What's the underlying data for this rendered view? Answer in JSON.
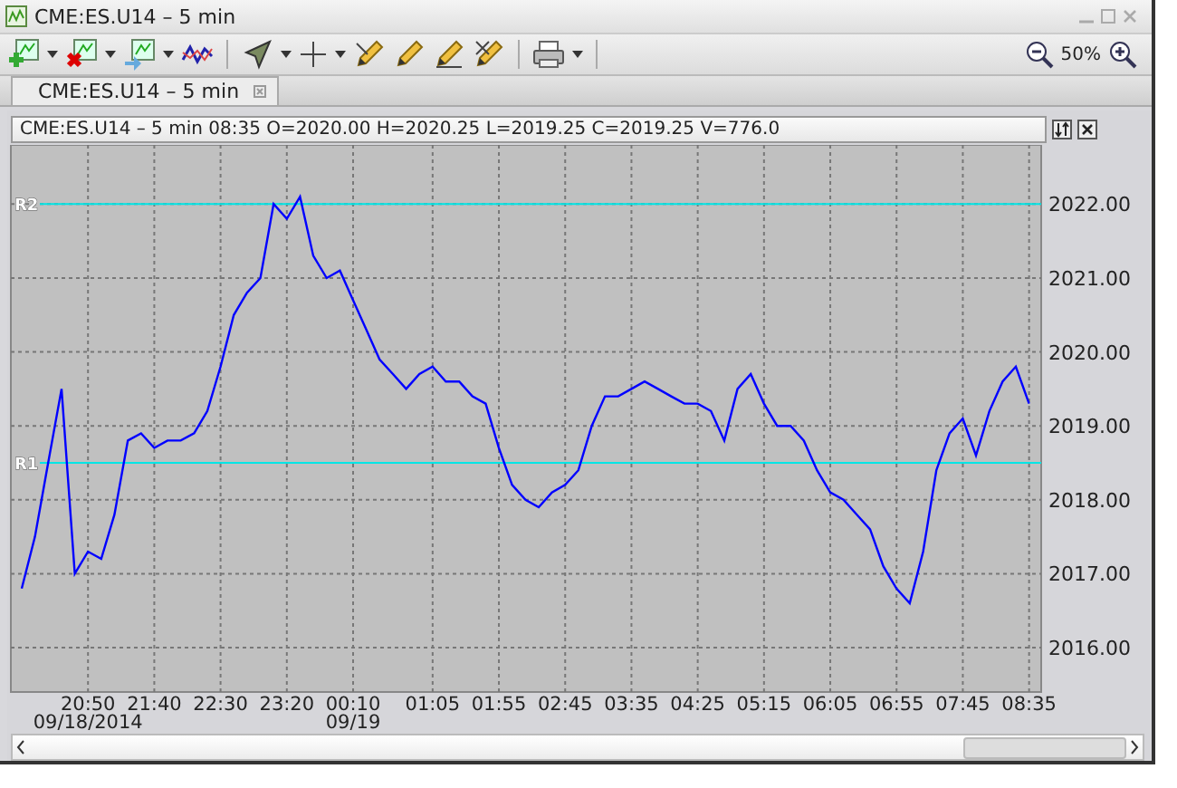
{
  "window": {
    "title": "CME:ES.U14 – 5 min"
  },
  "toolbar": {
    "zoom": "50%"
  },
  "tabs": [
    {
      "label": "CME:ES.U14 – 5 min",
      "selected": true
    }
  ],
  "chart_panel": {
    "header": "CME:ES.U14 – 5 min 08:35 O=2020.00 H=2020.25 L=2019.25 C=2019.25 V=776.0",
    "chart_data": {
      "type": "line",
      "categories": [
        null,
        null,
        null,
        null,
        null,
        "20:50\n09/18/2014",
        null,
        null,
        null,
        null,
        "21:40",
        null,
        null,
        null,
        null,
        "22:30",
        null,
        null,
        null,
        null,
        "23:20",
        null,
        null,
        null,
        null,
        "00:10\n09/19",
        null,
        null,
        null,
        null,
        null,
        "01:05",
        null,
        null,
        null,
        null,
        "01:55",
        null,
        null,
        null,
        null,
        "02:45",
        null,
        null,
        null,
        null,
        "03:35",
        null,
        null,
        null,
        null,
        "04:25",
        null,
        null,
        null,
        null,
        "05:15",
        null,
        null,
        null,
        null,
        "06:05",
        null,
        null,
        null,
        null,
        "06:55",
        null,
        null,
        null,
        null,
        "07:45",
        null,
        null,
        null,
        null,
        "08:35"
      ],
      "series": [
        {
          "color": "#0000ff",
          "values": [
            2016.8,
            2017.5,
            2018.5,
            2019.5,
            2017.0,
            2017.3,
            2017.2,
            2017.8,
            2018.8,
            2018.9,
            2018.7,
            2018.8,
            2018.8,
            2018.9,
            2019.2,
            2019.8,
            2020.5,
            2020.8,
            2021.0,
            2022.0,
            2021.8,
            2022.1,
            2021.3,
            2021.0,
            2021.1,
            2020.7,
            2020.3,
            2019.9,
            2019.7,
            2019.5,
            2019.7,
            2019.8,
            2019.6,
            2019.6,
            2019.4,
            2019.3,
            2018.7,
            2018.2,
            2018.0,
            2017.9,
            2018.1,
            2018.2,
            2018.4,
            2019.0,
            2019.4,
            2019.4,
            2019.5,
            2019.6,
            2019.5,
            2019.4,
            2019.3,
            2019.3,
            2019.2,
            2018.8,
            2019.5,
            2019.7,
            2019.3,
            2019.0,
            2019.0,
            2018.8,
            2018.4,
            2018.1,
            2018.0,
            2017.8,
            2017.6,
            2017.1,
            2016.8,
            2016.6,
            2017.3,
            2018.4,
            2018.9,
            2019.1,
            2018.6,
            2019.2,
            2019.6,
            2019.8,
            2019.3
          ]
        }
      ],
      "ylim": [
        2015.4,
        2022.8
      ],
      "yticks": [
        {
          "value": 2016,
          "label": "2016.00"
        },
        {
          "value": 2017,
          "label": "2017.00"
        },
        {
          "value": 2018,
          "label": "2018.00"
        },
        {
          "value": 2019,
          "label": "2019.00"
        },
        {
          "value": 2020,
          "label": "2020.00"
        },
        {
          "value": 2021,
          "label": "2021.00"
        },
        {
          "value": 2022,
          "label": "2022.00"
        }
      ],
      "grid": true,
      "ref_lines": [
        {
          "axis": "y",
          "value": 2022.0,
          "label": "R2"
        },
        {
          "axis": "y",
          "value": 2018.5,
          "label": "R1"
        }
      ]
    }
  }
}
